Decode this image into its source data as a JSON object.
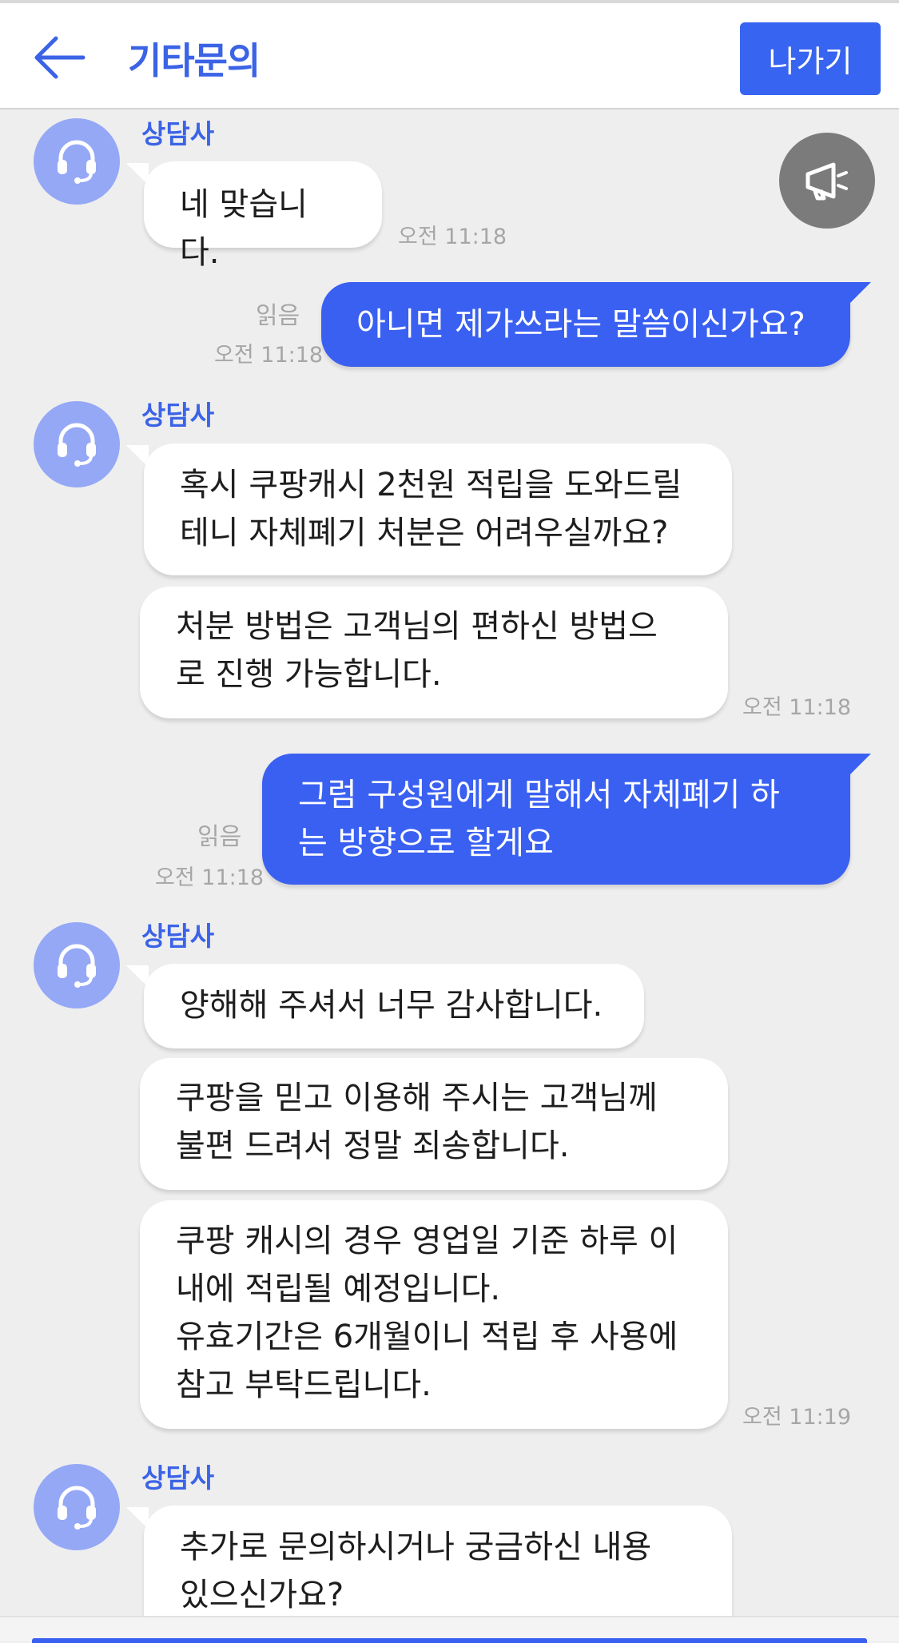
{
  "header": {
    "title": "기타문의",
    "exit_label": "나가기",
    "back_icon": "arrow-left-icon"
  },
  "colors": {
    "accent": "#3b63e6",
    "outgoing_bubble": "#3a60f2",
    "avatar_bg": "#95a8f6",
    "background": "#eeeeee"
  },
  "messages": [
    {
      "sender": "상담사",
      "bubbles": [
        "네 맞습니다."
      ],
      "time": "오전 11:18"
    },
    {
      "outgoing": true,
      "text": "아니면 제가쓰라는 말씀이신가요?",
      "read": "읽음",
      "time": "오전 11:18"
    },
    {
      "sender": "상담사",
      "bubbles": [
        "혹시 쿠팡캐시 2천원 적립을 도와드릴\n테니 자체폐기 처분은 어려우실까요?",
        "처분 방법은 고객님의 편하신 방법으\n로 진행 가능합니다."
      ],
      "time": "오전 11:18"
    },
    {
      "outgoing": true,
      "text": "그럼 구성원에게 말해서 자체폐기 하\n는 방향으로 할게요",
      "read": "읽음",
      "time": "오전 11:18"
    },
    {
      "sender": "상담사",
      "bubbles": [
        "양해해 주셔서 너무 감사합니다.",
        "쿠팡을 믿고 이용해 주시는 고객님께\n불편 드려서 정말 죄송합니다.",
        "쿠팡 캐시의 경우 영업일 기준 하루 이\n내에 적립될 예정입니다.\n유효기간은 6개월이니 적립 후 사용에\n참고 부탁드립니다."
      ],
      "time": "오전 11:19"
    },
    {
      "sender": "상담사",
      "bubbles": [
        "추가로 문의하시거나 궁금하신 내용\n있으신가요?"
      ]
    }
  ],
  "icons": {
    "avatar": "headset-icon",
    "floating_button": "megaphone-icon"
  }
}
